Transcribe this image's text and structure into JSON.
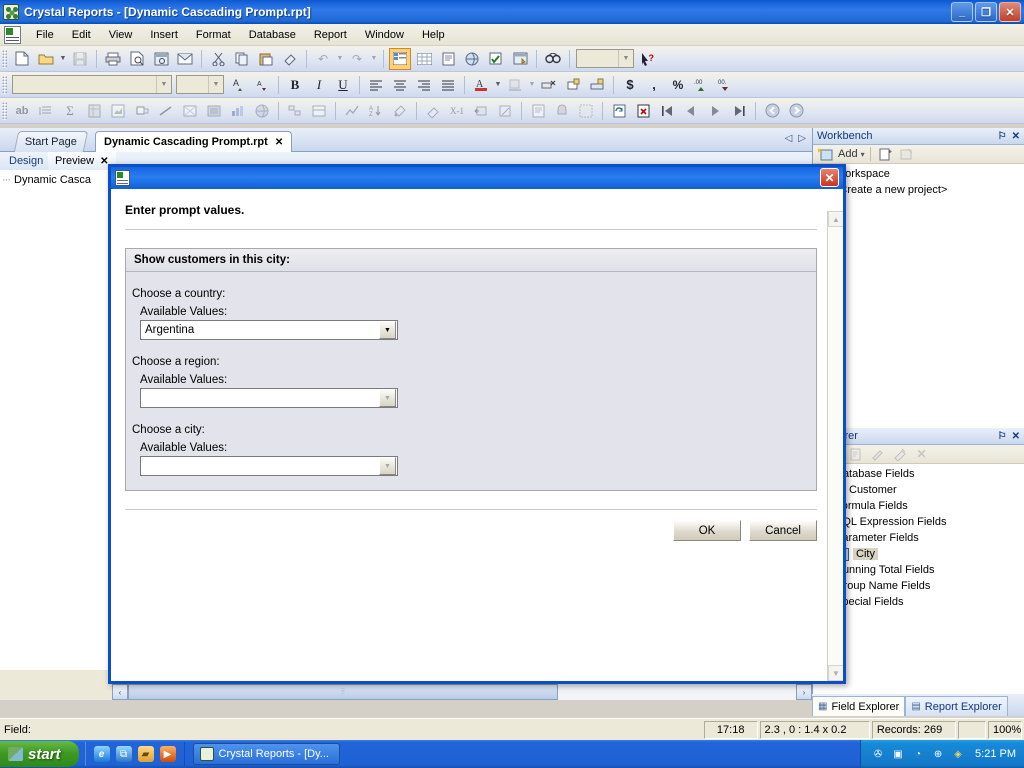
{
  "window": {
    "title": "Crystal Reports - [Dynamic Cascading Prompt.rpt]",
    "app_icon": "crystal-reports-icon",
    "minimize": "_",
    "restore": "❐",
    "close": "✕"
  },
  "menu": {
    "items": [
      {
        "label": "File"
      },
      {
        "label": "Edit"
      },
      {
        "label": "View"
      },
      {
        "label": "Insert"
      },
      {
        "label": "Format"
      },
      {
        "label": "Database"
      },
      {
        "label": "Report"
      },
      {
        "label": "Window"
      },
      {
        "label": "Help"
      }
    ]
  },
  "toolbars": {
    "row1": [
      {
        "icon": "new-document-icon"
      },
      {
        "icon": "open-folder-icon"
      },
      {
        "icon": "open-dropdown-icon"
      },
      {
        "icon": "save-icon"
      },
      {
        "sep": true
      },
      {
        "icon": "print-icon"
      },
      {
        "icon": "print-preview-icon"
      },
      {
        "icon": "page-setup-icon"
      },
      {
        "icon": "export-icon"
      },
      {
        "sep": true
      },
      {
        "icon": "cut-icon"
      },
      {
        "icon": "copy-icon"
      },
      {
        "icon": "paste-icon"
      },
      {
        "icon": "format-painter-icon"
      },
      {
        "sep": true
      },
      {
        "icon": "undo-icon"
      },
      {
        "icon": "undo-dropdown-icon"
      },
      {
        "icon": "redo-icon"
      },
      {
        "icon": "redo-dropdown-icon"
      },
      {
        "sep": true
      },
      {
        "icon": "field-explorer-icon"
      },
      {
        "icon": "grid-icon"
      },
      {
        "icon": "report-icon"
      },
      {
        "icon": "group-tree-icon"
      },
      {
        "icon": "select-expert-icon"
      },
      {
        "icon": "preview-sample-icon"
      },
      {
        "sep": true
      },
      {
        "icon": "find-icon"
      },
      {
        "sep": true
      },
      {
        "icon": "zoom-combo"
      },
      {
        "icon": "help-pointer-icon"
      }
    ],
    "row2": [
      {
        "icon": "font-name-combo"
      },
      {
        "icon": "font-size-combo"
      },
      {
        "icon": "increase-font-icon"
      },
      {
        "icon": "decrease-font-icon"
      },
      {
        "sep": true
      },
      {
        "icon": "bold-icon",
        "glyph": "B"
      },
      {
        "icon": "italic-icon",
        "glyph": "I"
      },
      {
        "icon": "underline-icon",
        "glyph": "U"
      },
      {
        "sep": true
      },
      {
        "icon": "align-left-icon"
      },
      {
        "icon": "align-center-icon"
      },
      {
        "icon": "align-right-icon"
      },
      {
        "icon": "align-justify-icon"
      },
      {
        "sep": true
      },
      {
        "icon": "font-color-icon"
      },
      {
        "icon": "font-color-dropdown-icon"
      },
      {
        "icon": "fill-color-icon"
      },
      {
        "icon": "fill-color-dropdown-icon"
      },
      {
        "icon": "suppress-icon"
      },
      {
        "icon": "lock-size-icon"
      },
      {
        "icon": "lock-position-icon"
      },
      {
        "sep": true
      },
      {
        "icon": "currency-icon",
        "glyph": "$"
      },
      {
        "icon": "thousands-separator-icon",
        "glyph": ","
      },
      {
        "icon": "percent-icon",
        "glyph": "%"
      },
      {
        "icon": "increase-decimal-icon"
      },
      {
        "icon": "decrease-decimal-icon"
      }
    ],
    "row3": [
      {
        "icon": "insert-text-object-icon",
        "glyph": "ab"
      },
      {
        "icon": "insert-summary-icon"
      },
      {
        "icon": "insert-sum-icon",
        "glyph": "Σ"
      },
      {
        "icon": "insert-crosstab-icon"
      },
      {
        "icon": "insert-subreport-icon"
      },
      {
        "icon": "insert-box-icon"
      },
      {
        "icon": "insert-line-icon"
      },
      {
        "icon": "insert-picture-icon"
      },
      {
        "icon": "insert-ole-icon"
      },
      {
        "icon": "insert-chart-icon"
      },
      {
        "icon": "insert-map-icon"
      },
      {
        "sep": true
      },
      {
        "icon": "group-expert-icon"
      },
      {
        "icon": "section-expert-icon"
      },
      {
        "sep": true
      },
      {
        "icon": "chart-expert-icon"
      },
      {
        "icon": "sort-expert-icon"
      },
      {
        "icon": "highlight-expert-icon"
      },
      {
        "sep": true
      },
      {
        "icon": "parameter-icon"
      },
      {
        "icon": "formula-workshop-icon"
      },
      {
        "icon": "insert-running-total-icon"
      },
      {
        "icon": "insert-special-field-icon"
      },
      {
        "sep": true
      },
      {
        "icon": "document-properties-icon"
      },
      {
        "icon": "report-alerts-icon"
      },
      {
        "icon": "toggle-design-icon"
      },
      {
        "sep": true
      },
      {
        "icon": "refresh-icon"
      },
      {
        "icon": "close-preview-icon"
      },
      {
        "icon": "first-page-icon"
      },
      {
        "icon": "previous-page-icon"
      },
      {
        "icon": "next-page-icon"
      },
      {
        "icon": "last-page-icon"
      },
      {
        "sep": true
      },
      {
        "icon": "back-icon"
      },
      {
        "icon": "forward-icon"
      }
    ]
  },
  "doc_tabs": {
    "tabs": [
      {
        "label": "Start Page",
        "active": false,
        "closable": false
      },
      {
        "label": "Dynamic Cascading Prompt.rpt",
        "active": true,
        "closable": true
      }
    ],
    "close_glyph": "✕",
    "nav_prev": "◁",
    "nav_next": "▷"
  },
  "view_tabs": {
    "tabs": [
      {
        "label": "Design",
        "selected": false
      },
      {
        "label": "Preview",
        "selected": true
      }
    ],
    "close_glyph": "✕"
  },
  "group_tree": {
    "items": [
      {
        "label": "Dynamic Casca"
      }
    ]
  },
  "dialog": {
    "icon": "report-document-icon",
    "close_glyph": "✕",
    "heading": "Enter prompt values.",
    "group_title": "Show customers in this city:",
    "prompts": [
      {
        "label": "Choose a country:",
        "values_label": "Available Values:",
        "value": "Argentina",
        "enabled": true
      },
      {
        "label": "Choose a region:",
        "values_label": "Available Values:",
        "value": "",
        "enabled": false
      },
      {
        "label": "Choose a city:",
        "values_label": "Available Values:",
        "value": "",
        "enabled": false
      }
    ],
    "dropdown_glyph": "▼",
    "buttons": [
      {
        "label": "OK",
        "name": "ok-button"
      },
      {
        "label": "Cancel",
        "name": "cancel-button"
      }
    ],
    "scroll_up": "▲",
    "scroll_down": "▼"
  },
  "workbench": {
    "title": "Workbench",
    "pin_glyph": "⚐",
    "close_glyph": "✕",
    "toolbar": {
      "add_label": "Add",
      "add_dropdown": "▾",
      "buttons": [
        {
          "icon": "add-project-icon"
        },
        {
          "icon": "new-folder-icon"
        },
        {
          "icon": "open-item-icon"
        }
      ]
    },
    "tree": [
      {
        "label": "Workspace",
        "indent": 0,
        "icon": "workspace-icon"
      },
      {
        "label": "<Create a new project>",
        "indent": 1,
        "icon": "new-project-icon"
      }
    ]
  },
  "field_explorer": {
    "title": "Explorer",
    "pin_glyph": "⚐",
    "close_glyph": "✕",
    "toolbar": [
      {
        "icon": "insert-to-report-icon"
      },
      {
        "icon": "new-field-icon"
      },
      {
        "icon": "edit-field-icon"
      },
      {
        "icon": "rename-field-icon"
      },
      {
        "icon": "delete-field-icon",
        "glyph": "✕"
      }
    ],
    "tree": [
      {
        "label": "Database Fields",
        "indent": 0,
        "icon": "database-fields-icon",
        "glyph": "⛃",
        "selected": false
      },
      {
        "label": "Customer",
        "indent": 1,
        "icon": "table-icon",
        "glyph": "▤",
        "selected": false,
        "expander": "+"
      },
      {
        "label": "Formula Fields",
        "indent": 0,
        "icon": "formula-fields-icon",
        "glyph": "ƒ",
        "selected": false
      },
      {
        "label": "SQL Expression Fields",
        "indent": 0,
        "icon": "sql-expression-fields-icon",
        "glyph": "▣",
        "selected": false
      },
      {
        "label": "Parameter Fields",
        "indent": 0,
        "icon": "parameter-fields-icon",
        "glyph": "?",
        "selected": false
      },
      {
        "label": "City",
        "indent": 1,
        "icon": "parameter-field-icon",
        "glyph": "▭",
        "selected": true
      },
      {
        "label": "Running Total Fields",
        "indent": 0,
        "icon": "running-total-fields-icon",
        "glyph": "Σ",
        "selected": false
      },
      {
        "label": "Group Name Fields",
        "indent": 0,
        "icon": "group-name-fields-icon",
        "glyph": "≡",
        "selected": false
      },
      {
        "label": "Special Fields",
        "indent": 0,
        "icon": "special-fields-icon",
        "glyph": "✶",
        "selected": false
      }
    ],
    "bottom_tabs": [
      {
        "label": "Field Explorer",
        "selected": true,
        "icon": "field-explorer-icon"
      },
      {
        "label": "Report Explorer",
        "selected": false,
        "icon": "report-explorer-icon"
      }
    ]
  },
  "preview_scroll": {
    "left_glyph": "‹",
    "right_glyph": "›",
    "down_glyph": "⌄"
  },
  "statusbar": {
    "field_label": "Field:",
    "time": "17:18",
    "coords": "2.3 , 0 : 1.4 x 0.2",
    "records": "Records:  269",
    "blank": "",
    "zoom": "100%"
  },
  "taskbar": {
    "start_label": "start",
    "quick_launch": [
      {
        "icon": "internet-explorer-icon",
        "glyph": "e"
      },
      {
        "icon": "show-desktop-icon",
        "glyph": "⧉"
      },
      {
        "icon": "folder-icon",
        "glyph": "▰"
      },
      {
        "icon": "media-player-icon",
        "glyph": "▶"
      }
    ],
    "tasks": [
      {
        "label": "Crystal Reports - [Dy...",
        "icon": "crystal-reports-icon"
      }
    ],
    "tray": {
      "icons": [
        {
          "icon": "network-activity-icon",
          "glyph": "✇"
        },
        {
          "icon": "monitor-icon",
          "glyph": "▣"
        },
        {
          "icon": "volume-icon",
          "glyph": "◔"
        },
        {
          "icon": "update-icon",
          "glyph": "⊕"
        },
        {
          "icon": "shield-icon",
          "glyph": "◈"
        }
      ],
      "clock": "5:21 PM"
    }
  },
  "colors": {
    "titlebar_blue": "#1560d8",
    "dialog_border": "#0a4fc8",
    "accent_orange": "#ffd07a",
    "panel_bg": "#fdfdf8",
    "groupbox_bg": "#e3e3eb",
    "status_bg": "#ece9d8",
    "taskbar_blue": "#2064d8",
    "start_green": "#3f9a25"
  }
}
